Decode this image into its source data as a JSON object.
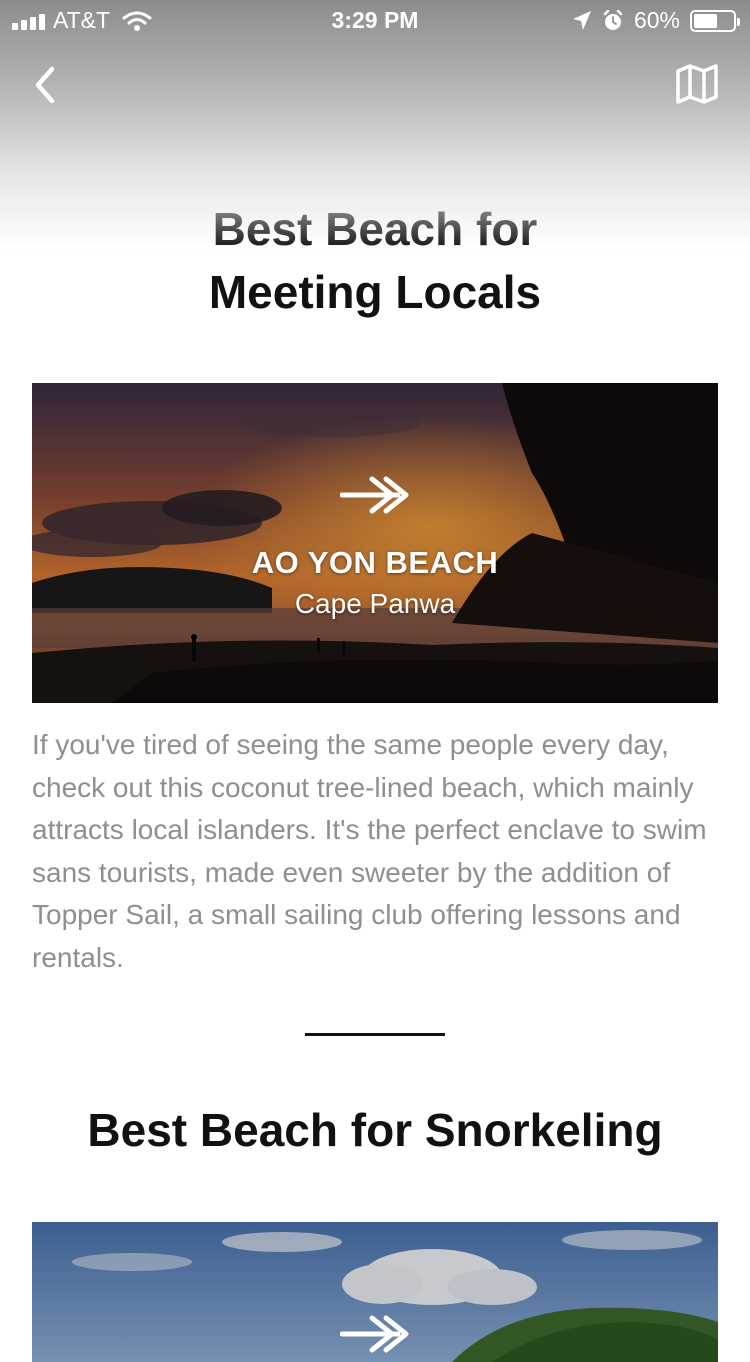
{
  "status_bar": {
    "carrier": "AT&T",
    "time": "3:29 PM",
    "battery": "60%",
    "battery_level": 0.6
  },
  "nav": {
    "back_icon": "chevron-left-icon",
    "map_icon": "map-icon"
  },
  "sections": [
    {
      "title_line1": "Best Beach for",
      "title_line2": "Meeting Locals",
      "card": {
        "name": "AO YON BEACH",
        "location": "Cape Panwa",
        "arrow_icon": "double-arrow-right-icon"
      },
      "description": "If you've tired of seeing the same people every day, check out this coconut tree-lined beach, which mainly attracts local islanders. It's the perfect enclave to swim sans tourists, made even sweeter by the addition of Topper Sail, a small sailing club offering lessons and rentals."
    },
    {
      "title": "Best Beach for Snorkeling",
      "card": {
        "arrow_icon": "double-arrow-right-icon"
      }
    }
  ]
}
